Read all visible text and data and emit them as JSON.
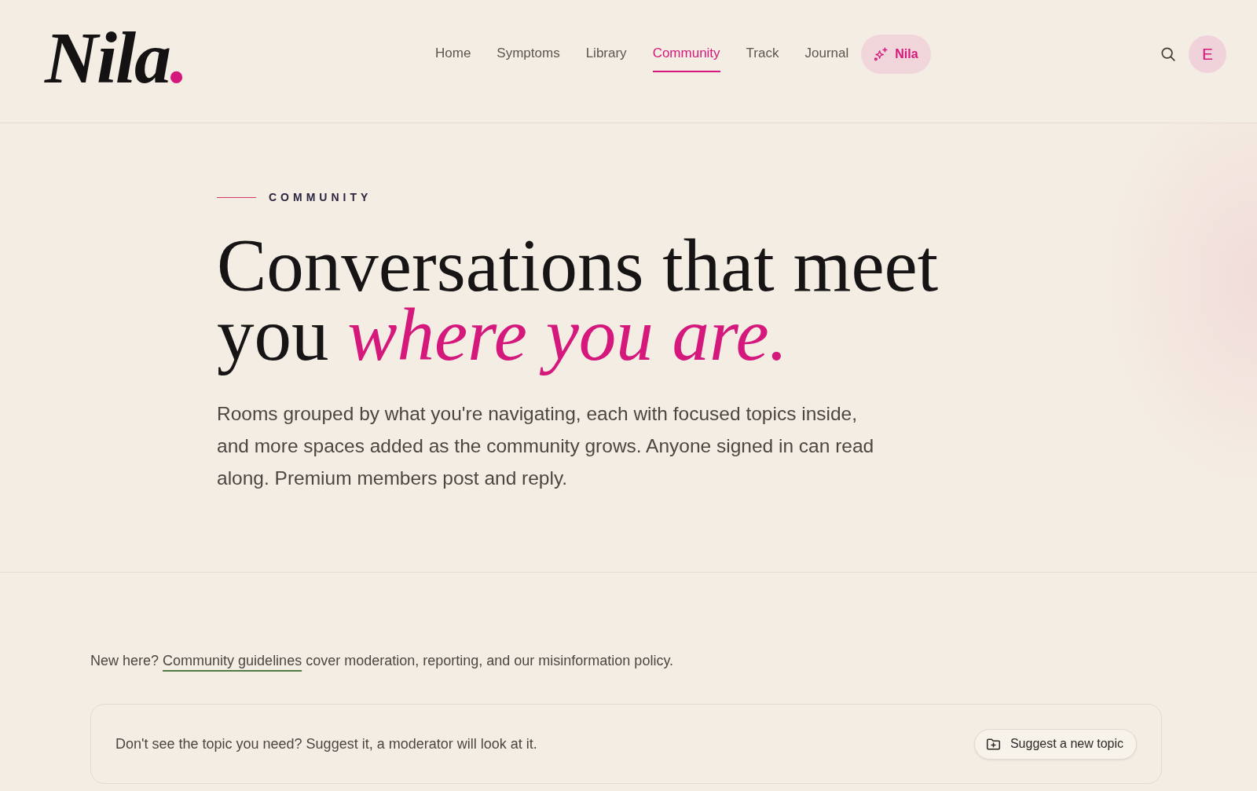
{
  "header": {
    "logo": {
      "text": "Nila",
      "accent": "."
    },
    "nav": [
      {
        "label": "Home",
        "selected": false
      },
      {
        "label": "Symptoms",
        "selected": false
      },
      {
        "label": "Library",
        "selected": false
      },
      {
        "label": "Community",
        "selected": true
      },
      {
        "label": "Track",
        "selected": false
      },
      {
        "label": "Journal",
        "selected": false
      }
    ],
    "assistant_button": {
      "label": "Nila"
    },
    "avatar": {
      "initial": "E"
    }
  },
  "hero": {
    "eyebrow": "COMMUNITY",
    "heading": "Conversations that meet you *where you are.*",
    "intro": "Rooms grouped by what you're navigating, each with focused topics inside, and more spaces added as the community grows. Anyone signed in can read along. Premium members post and reply."
  },
  "guidelines": {
    "lead": "New here?",
    "link": "Community guidelines",
    "rest": "cover moderation, reporting, and our misinformation policy."
  },
  "suggest": {
    "prompt": "Don't see the topic you need? Suggest it, a moderator will look at it.",
    "button": "Suggest a new topic"
  }
}
